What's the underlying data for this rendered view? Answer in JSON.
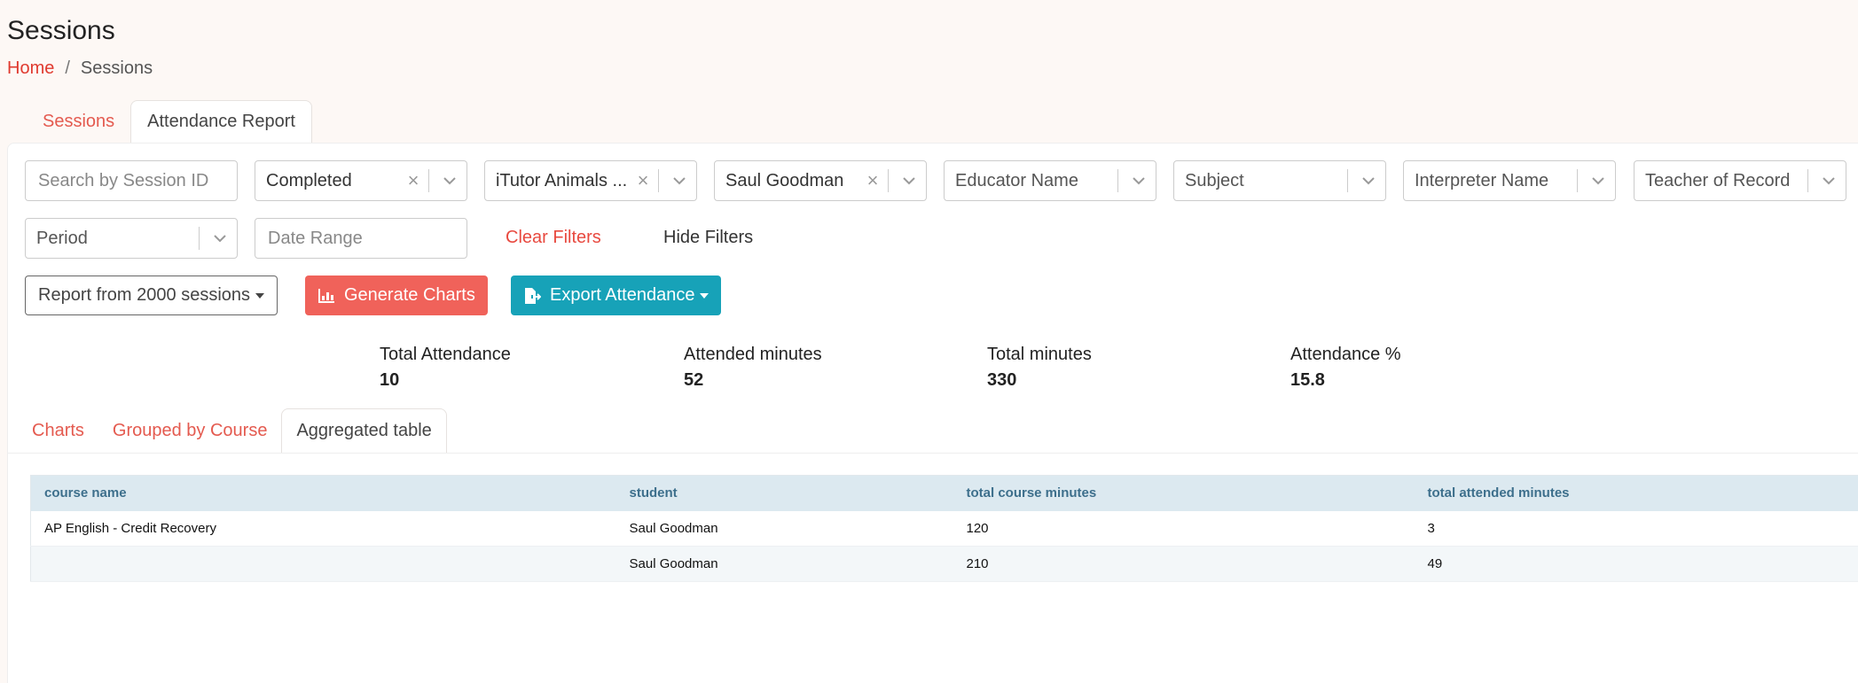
{
  "page": {
    "title": "Sessions",
    "breadcrumb": {
      "home": "Home",
      "separator": "/",
      "current": "Sessions"
    }
  },
  "top_tabs": [
    {
      "label": "Sessions",
      "active": false
    },
    {
      "label": "Attendance Report",
      "active": true
    }
  ],
  "filters": {
    "session_search": {
      "placeholder": "Search by Session ID",
      "value": ""
    },
    "status": {
      "value": "Completed"
    },
    "program": {
      "value": "iTutor Animals ..."
    },
    "student": {
      "value": "Saul Goodman"
    },
    "educator": {
      "placeholder": "Educator Name"
    },
    "subject": {
      "placeholder": "Subject"
    },
    "interpreter": {
      "placeholder": "Interpreter Name"
    },
    "teacher_of_record": {
      "placeholder": "Teacher of Record"
    },
    "period": {
      "placeholder": "Period"
    },
    "date_range": {
      "placeholder": "Date Range",
      "value": ""
    },
    "clear_label": "Clear Filters",
    "hide_label": "Hide Filters"
  },
  "actions": {
    "report_label": "Report from 2000 sessions",
    "generate_label": "Generate Charts",
    "export_label": "Export Attendance"
  },
  "stats": [
    {
      "label": "Total Attendance",
      "value": "10"
    },
    {
      "label": "Attended minutes",
      "value": "52"
    },
    {
      "label": "Total minutes",
      "value": "330"
    },
    {
      "label": "Attendance %",
      "value": "15.8"
    }
  ],
  "sub_tabs": [
    {
      "label": "Charts",
      "active": false
    },
    {
      "label": "Grouped by Course",
      "active": false
    },
    {
      "label": "Aggregated table",
      "active": true
    }
  ],
  "table": {
    "columns": [
      "course name",
      "student",
      "total course minutes",
      "total attended minutes"
    ],
    "rows": [
      [
        "AP English - Credit Recovery",
        "Saul Goodman",
        "120",
        "3"
      ],
      [
        "",
        "Saul Goodman",
        "210",
        "49"
      ]
    ]
  },
  "colors": {
    "accent_red": "#e03a2f",
    "button_red": "#f0625a",
    "button_teal": "#17a2b8",
    "table_header_bg": "#dce9f0",
    "table_header_text": "#3d6f8c",
    "page_bg": "#fdf8f5"
  },
  "icons": {
    "generate": "bar-chart-icon",
    "export": "file-export-icon",
    "select_clear": "x-icon",
    "select_open": "chevron-down-icon"
  }
}
